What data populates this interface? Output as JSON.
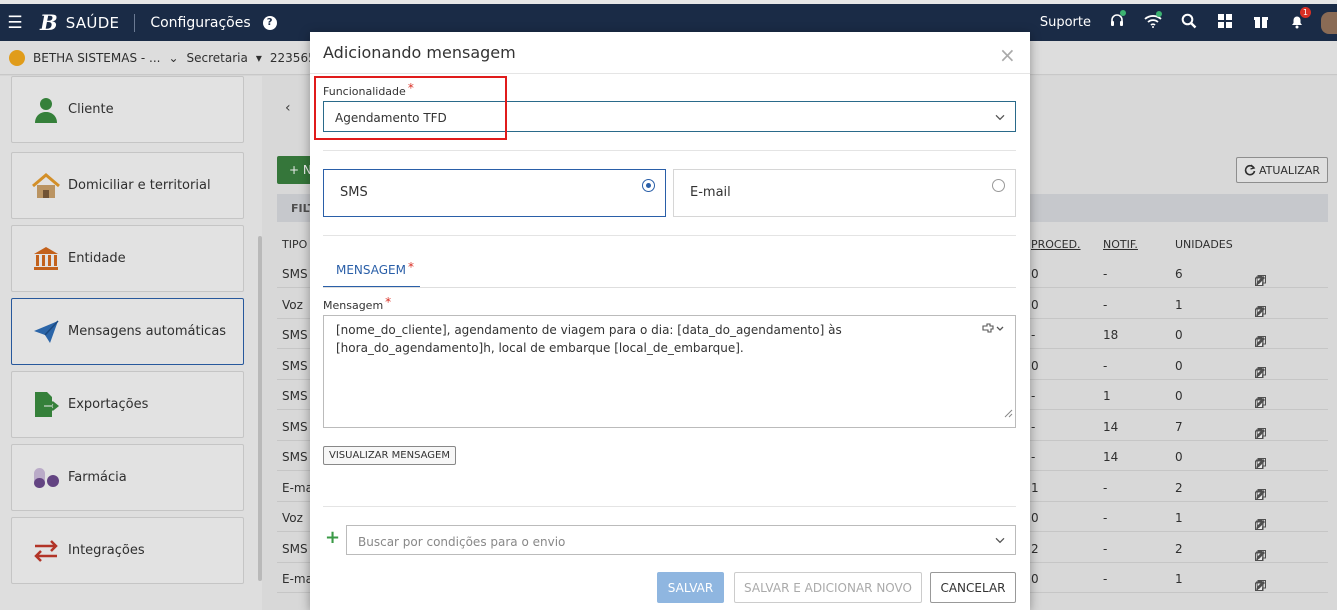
{
  "topbar": {
    "menu_icon": "☰",
    "logo": "B",
    "app_name": "SAÚDE",
    "section": "Configurações",
    "help_icon": "?",
    "support_label": "Suporte",
    "notification_count": "1"
  },
  "subbar": {
    "org": "BETHA SISTEMAS - ...",
    "org_chevron": "⌄",
    "secretaria": "Secretaria",
    "secretaria_chevron": "▾",
    "code": "223565"
  },
  "sidebar": {
    "items": [
      {
        "label": "Cliente",
        "icon": "user-icon"
      },
      {
        "label": "Domiciliar e territorial",
        "icon": "house-icon"
      },
      {
        "label": "Entidade",
        "icon": "bank-icon"
      },
      {
        "label": "Mensagens automáticas",
        "icon": "paper-plane-icon"
      },
      {
        "label": "Exportações",
        "icon": "export-file-icon"
      },
      {
        "label": "Farmácia",
        "icon": "pills-icon"
      },
      {
        "label": "Integrações",
        "icon": "swap-arrows-icon"
      }
    ],
    "active_index": 3
  },
  "background": {
    "back_chevron": "‹",
    "add_button": "+ N",
    "refresh_button": "ATUALIZAR",
    "filter_label": "FILT",
    "columns": {
      "tipo": "TIPO",
      "proced": "PROCED.",
      "notif": "NOTIF.",
      "unidades": "UNIDADES"
    },
    "rows": [
      {
        "tipo": "SMS",
        "proced": "0",
        "notif": "-",
        "unidades": "6"
      },
      {
        "tipo": "Voz",
        "proced": "0",
        "notif": "-",
        "unidades": "1"
      },
      {
        "tipo": "SMS",
        "proced": "-",
        "notif": "18",
        "unidades": "0"
      },
      {
        "tipo": "SMS",
        "proced": "0",
        "notif": "-",
        "unidades": "0"
      },
      {
        "tipo": "SMS",
        "proced": "-",
        "notif": "1",
        "unidades": "0"
      },
      {
        "tipo": "SMS",
        "proced": "-",
        "notif": "14",
        "unidades": "7"
      },
      {
        "tipo": "SMS",
        "proced": "-",
        "notif": "14",
        "unidades": "0"
      },
      {
        "tipo": "E-ma",
        "proced": "1",
        "notif": "-",
        "unidades": "2"
      },
      {
        "tipo": "Voz",
        "proced": "0",
        "notif": "-",
        "unidades": "1"
      },
      {
        "tipo": "SMS",
        "proced": "2",
        "notif": "-",
        "unidades": "2"
      },
      {
        "tipo": "E-ma",
        "proced": "0",
        "notif": "-",
        "unidades": "1"
      }
    ]
  },
  "modal": {
    "title": "Adicionando mensagem",
    "close": "×",
    "funcionalidade_label": "Funcionalidade",
    "required_mark": "*",
    "funcionalidade_value": "Agendamento TFD",
    "channel_sms": "SMS",
    "channel_email": "E-mail",
    "selected_channel": "SMS",
    "tab_label": "MENSAGEM",
    "mensagem_label": "Mensagem",
    "mensagem_value": "[nome_do_cliente], agendamento de viagem para o dia: [data_do_agendamento] às [hora_do_agendamento]h, local de embarque [local_de_embarque].",
    "preview_button": "VISUALIZAR MENSAGEM",
    "conditions_placeholder": "Buscar por condições para o envio",
    "save_button": "SALVAR",
    "save_new_button": "SALVAR E ADICIONAR NOVO",
    "cancel_button": "CANCELAR"
  },
  "colors": {
    "topbar": "#1a2b46",
    "accent": "#2a5fa8",
    "highlight": "#e01b1b",
    "save": "#8fb6e0",
    "add_green": "#3a7f3f"
  }
}
